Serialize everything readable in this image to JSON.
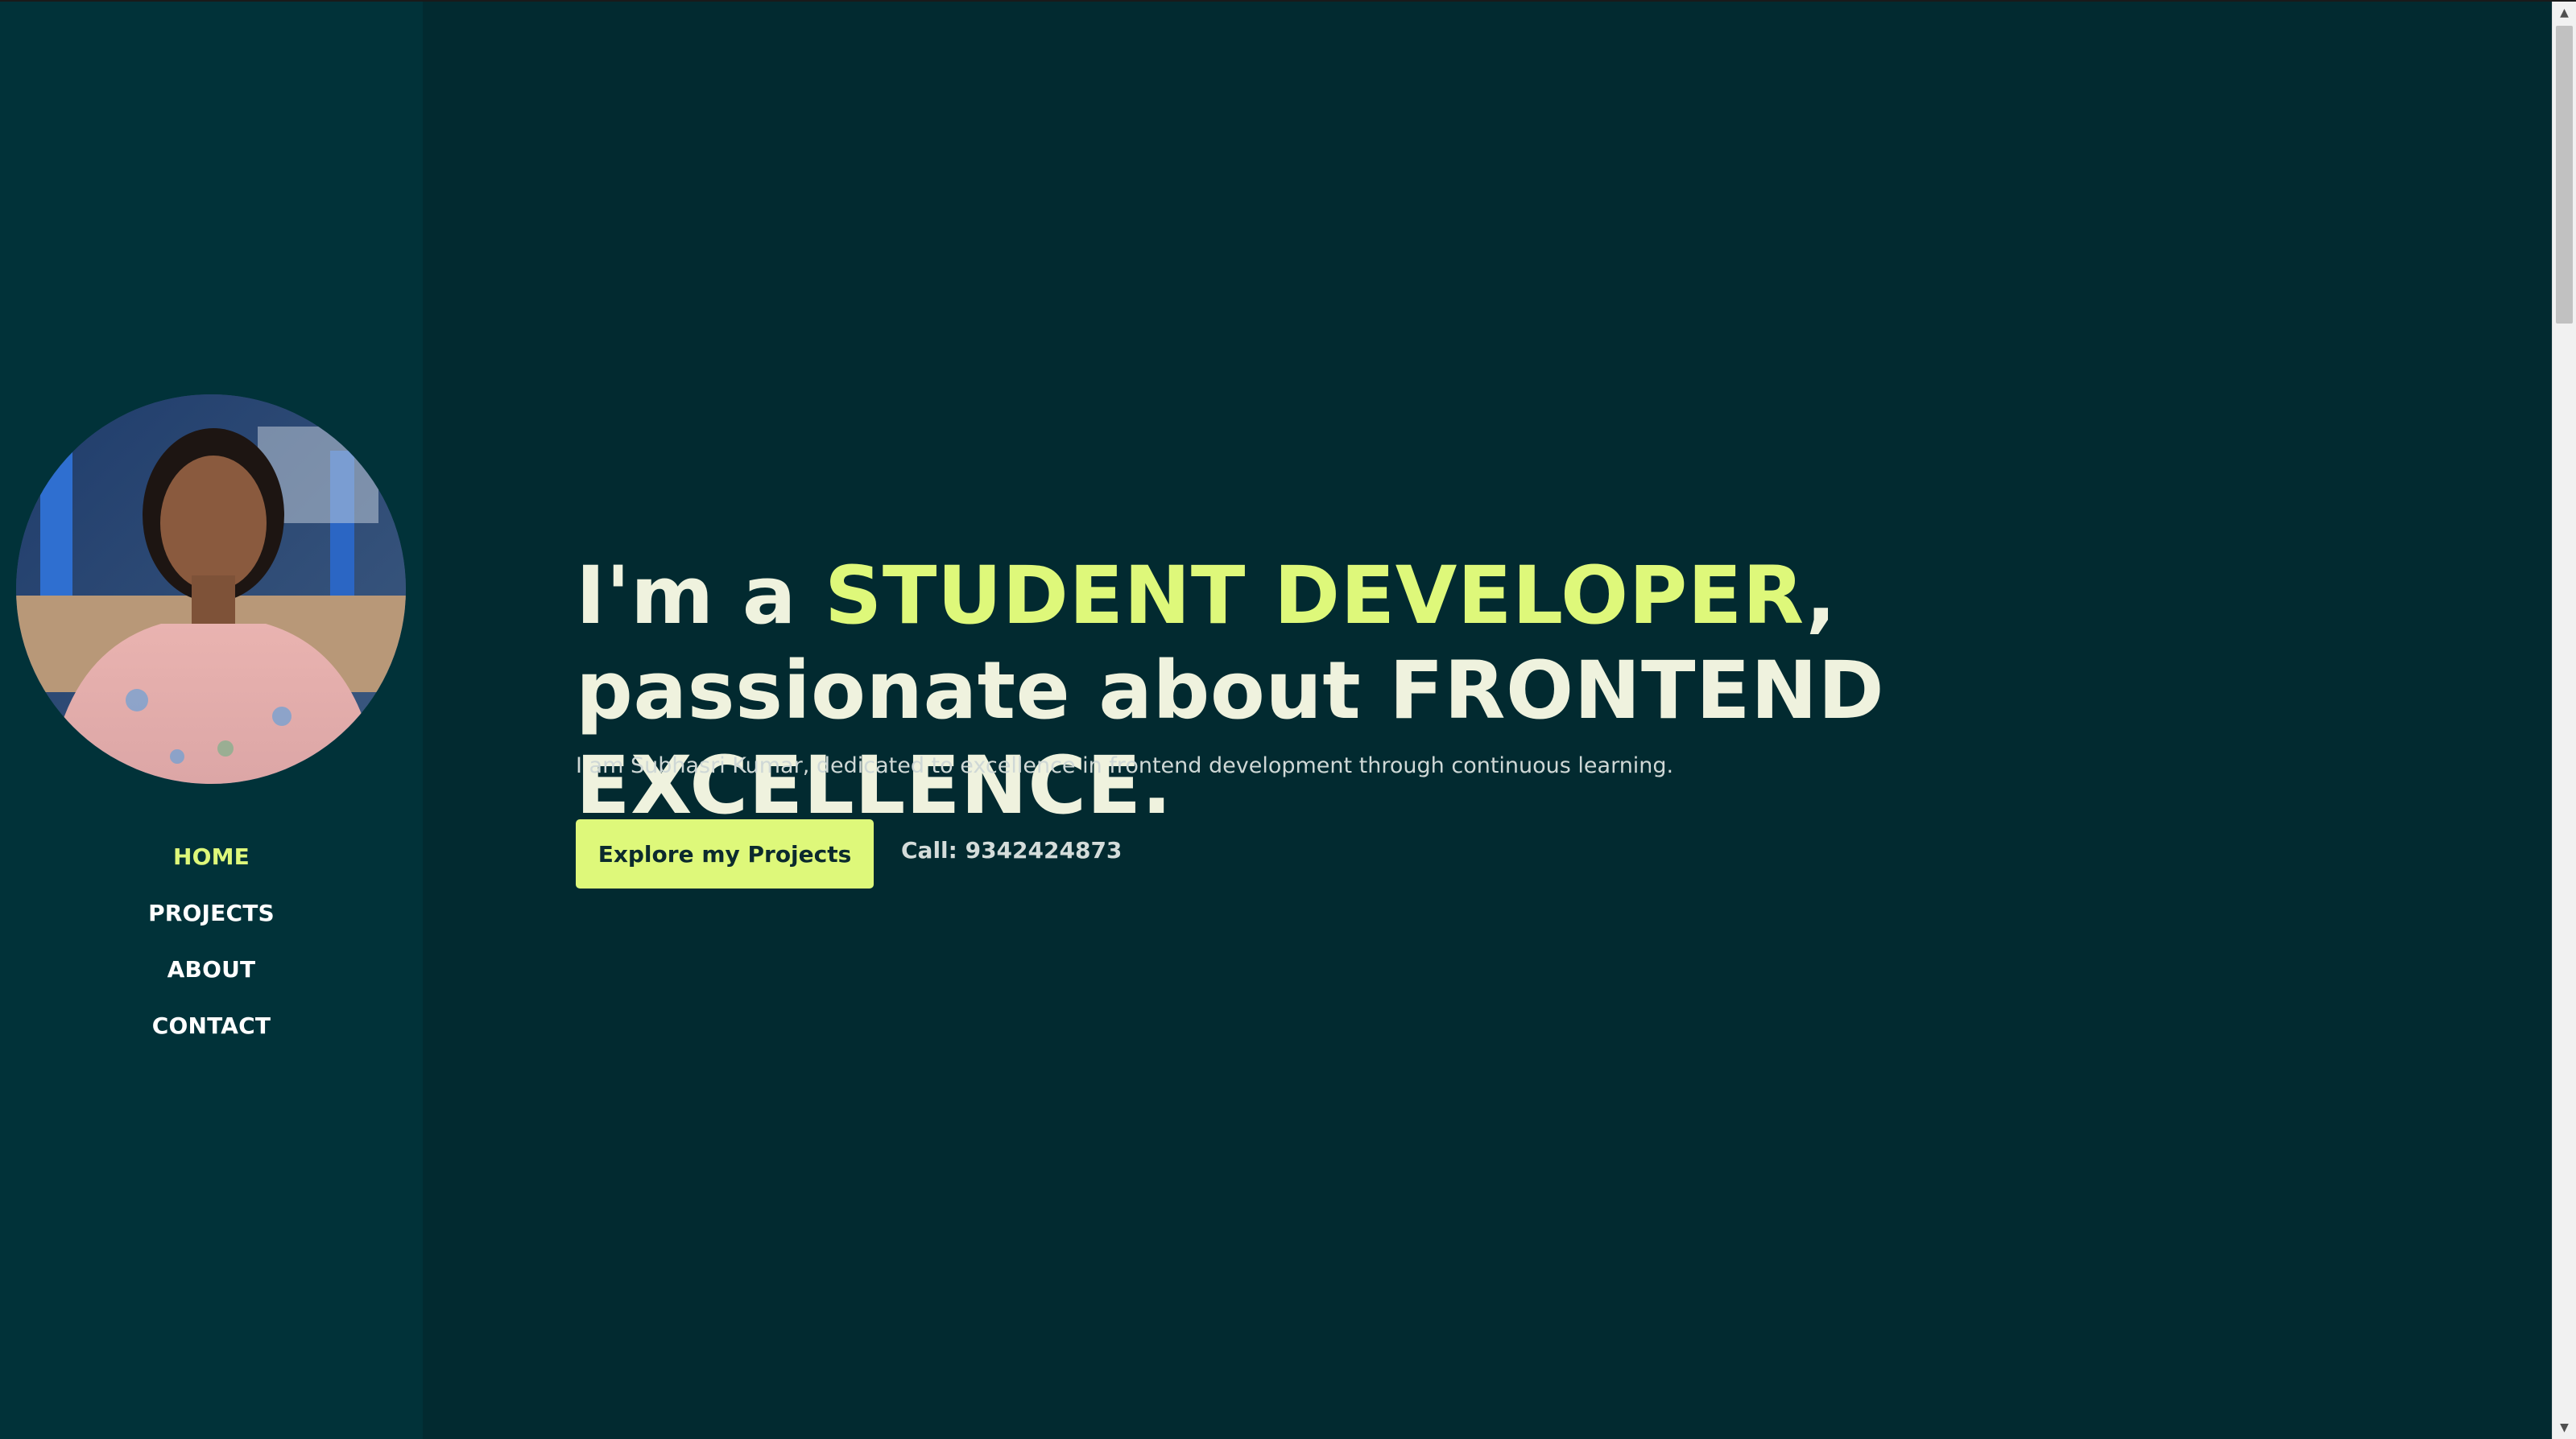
{
  "sidebar": {
    "avatar_alt": "Profile photo",
    "nav": [
      {
        "label": "HOME",
        "active": true
      },
      {
        "label": "PROJECTS",
        "active": false
      },
      {
        "label": "ABOUT",
        "active": false
      },
      {
        "label": "CONTACT",
        "active": false
      }
    ]
  },
  "hero": {
    "title_part1": "I'm a ",
    "title_highlight": "STUDENT DEVELOPER",
    "title_part2": ", passionate about FRONTEND EXCELLENCE.",
    "subtitle": "I am Subhasri Kumar, dedicated to excellence in frontend development through continuous learning.",
    "cta_label": "Explore my Projects",
    "phone_text": "Call: 9342424873"
  },
  "colors": {
    "sidebar_bg": "#013239",
    "main_bg": "#022a30",
    "accent": "#def87a",
    "text": "#eff2de"
  }
}
